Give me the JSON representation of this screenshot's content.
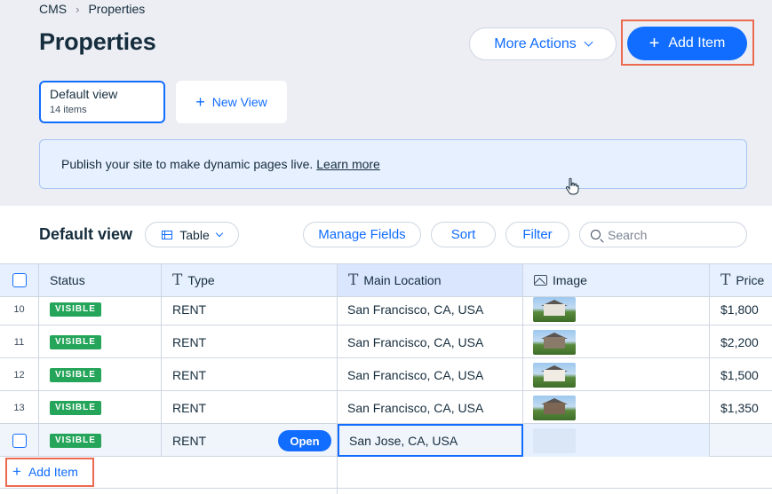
{
  "breadcrumb": {
    "root": "CMS",
    "current": "Properties"
  },
  "page": {
    "title": "Properties"
  },
  "actions": {
    "more_actions": "More Actions",
    "add_item": "Add Item"
  },
  "views": {
    "default": {
      "name": "Default view",
      "count": "14 items"
    },
    "new_view": "New View"
  },
  "notice": {
    "text": "Publish your site to make dynamic pages live.",
    "link": "Learn more"
  },
  "toolbar": {
    "title": "Default view",
    "layout": "Table",
    "manage_fields": "Manage Fields",
    "sort": "Sort",
    "filter": "Filter",
    "search_placeholder": "Search"
  },
  "columns": {
    "status": "Status",
    "type": "Type",
    "main_location": "Main Location",
    "image": "Image",
    "price": "Price"
  },
  "rows": [
    {
      "num": "10",
      "status": "VISIBLE",
      "type": "RENT",
      "location": "San Francisco, CA, USA",
      "price": "$1,800"
    },
    {
      "num": "11",
      "status": "VISIBLE",
      "type": "RENT",
      "location": "San Francisco, CA, USA",
      "price": "$2,200"
    },
    {
      "num": "12",
      "status": "VISIBLE",
      "type": "RENT",
      "location": "San Francisco, CA, USA",
      "price": "$1,500"
    },
    {
      "num": "13",
      "status": "VISIBLE",
      "type": "RENT",
      "location": "San Francisco, CA, USA",
      "price": "$1,350"
    },
    {
      "num": "",
      "status": "VISIBLE",
      "type": "RENT",
      "location": "San Jose, CA, USA",
      "price": "",
      "open": "Open"
    }
  ],
  "footer": {
    "add_item": "Add Item"
  },
  "colors": {
    "accent": "#116dff",
    "visible_badge": "#25a55a",
    "highlight": "#ec6a4f"
  }
}
